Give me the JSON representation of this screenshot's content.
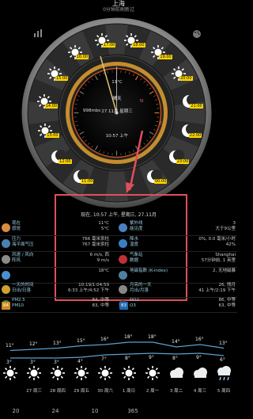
{
  "header": {
    "city": "上海",
    "subtitle": "0分钟前刷新过"
  },
  "dial": {
    "temp_top": "11°C",
    "condition": "晴天",
    "pressure": "998mbs",
    "date": "27 11月 星期三",
    "time": "10:57 上午",
    "north": "N",
    "east": "E",
    "badge_labels": [
      "11:00",
      "12:00",
      "13:00",
      "14:00",
      "15:00",
      "16:00",
      "17:00",
      "18:00",
      "19:00",
      "20:00",
      "21:00",
      "22:00",
      "23:00",
      "00:00"
    ]
  },
  "now_line": "现在, 10:57 上午, 星期三, 27.11月",
  "rows": [
    {
      "name": "temperature",
      "left_label": "现在\n感觉",
      "mid": "11°C\n5°C",
      "mid2_label": "紫外线\n能见度",
      "right": "3\n大于9公里"
    },
    {
      "name": "pressure",
      "left_label": "压力\n海平面气压",
      "mid": "766 毫米汞柱\n767 毫米汞柱",
      "mid2_label": "降水\n湿度",
      "right": "0%, 0.0 毫米/小时\n42%"
    },
    {
      "name": "wind",
      "left_label": "风速 / 风向\n阵风",
      "mid": "6 m/s, 西\n9 m/s",
      "mid2_label": "气象站\n数据",
      "right": "Shanghai\n57分钟前, 1 英里"
    },
    {
      "name": "dewpoint",
      "left_label": "",
      "mid": "18°C",
      "mid2_label": "地磁指数 (K-index)",
      "right": "2, 无地磁暴"
    },
    {
      "name": "sun",
      "left_label": "一天的时间\n日出/日落",
      "mid": "10:19/1:04:59\n6:33 上午/4:52 下午",
      "mid2_label": "月亮的一天\n月出/月落",
      "right": "26, 残月\n41 上午/2:19 下午"
    },
    {
      "name": "air",
      "left_label": "PM2.5\nPM10",
      "mid": "84, 中等\n83, 中等",
      "mid2_label": "NO2\nO3",
      "right": "86, 中等\n63, 中等"
    }
  ],
  "aqi_badges": [
    "84",
    "83"
  ],
  "forecast": {
    "highs": [
      "11°",
      "12°",
      "13°",
      "15°",
      "16°",
      "18°",
      "18°",
      "14°",
      "16°",
      "13°"
    ],
    "lows": [
      "3°",
      "3°",
      "3°",
      "4°",
      "7°",
      "8°",
      "9°",
      "8°",
      "9°",
      "6°"
    ],
    "days": [
      "",
      "27 周三",
      "28 周四",
      "29 周五",
      "30 周六",
      "1 周日",
      "2 周一",
      "3 周二",
      "4 周三",
      "5 周四"
    ],
    "bottom_numbers": [
      "20",
      "24",
      "10",
      "365",
      ""
    ]
  }
}
